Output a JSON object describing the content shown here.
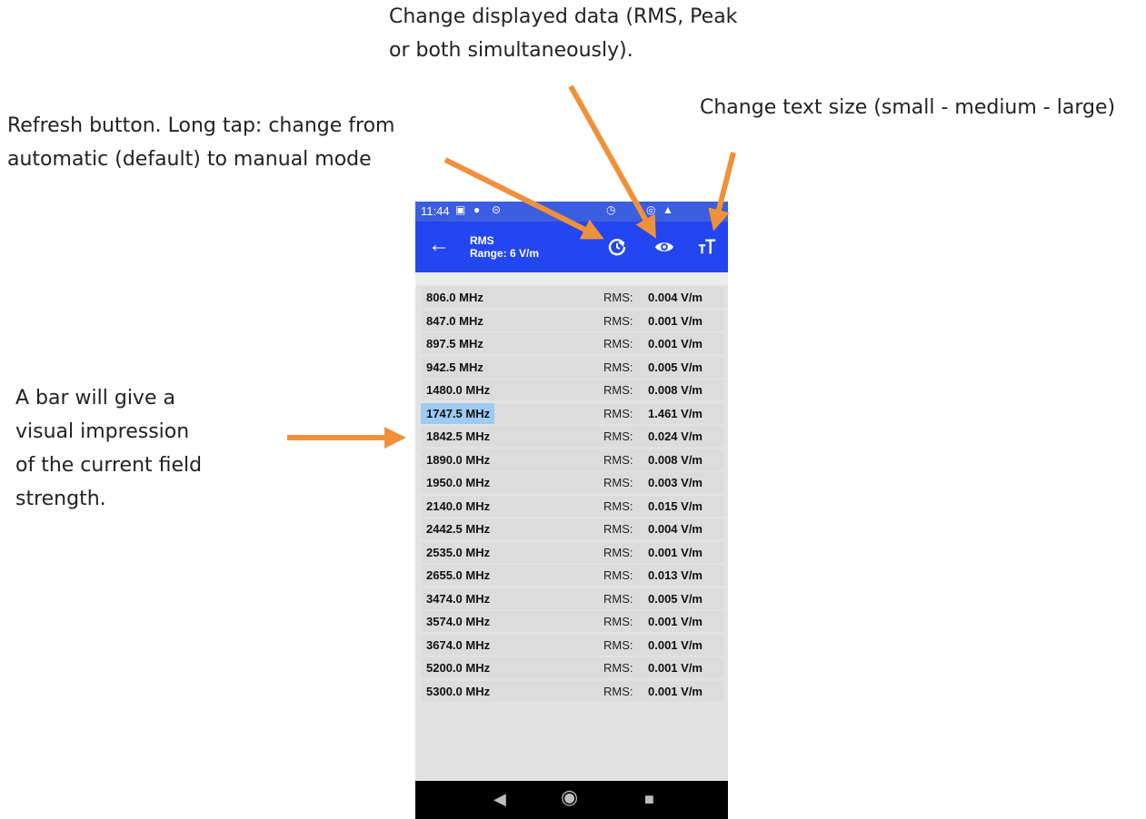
{
  "annotations": {
    "display_data": [
      "Change displayed data (RMS, Peak",
      "or both simultaneously)."
    ],
    "refresh": [
      "Refresh button. Long tap: change from",
      "automatic (default) to manual mode"
    ],
    "text_size": [
      "Change text size (small - medium - large)"
    ],
    "bar": [
      "A bar will give a",
      "visual impression",
      "of the current field",
      "strength."
    ]
  },
  "colors": {
    "arrow": "#f0913a",
    "appbar": "#2446f0",
    "bar": "#9ecbf4"
  },
  "statusbar": {
    "time": "11:44",
    "icons": [
      "calendar-icon",
      "app-icon",
      "link-icon",
      "alarm-icon",
      "hotspot-icon",
      "signal-4g-icon"
    ]
  },
  "appbar": {
    "title": "RMS",
    "subtitle": "Range: 6 V/m",
    "back_icon": "arrow-back-icon",
    "refresh_icon": "refresh-icon",
    "eye_icon": "eye-icon",
    "textsize_icon": "text-size-icon"
  },
  "list": {
    "label": "RMS:",
    "rows": [
      {
        "freq": "806.0 MHz",
        "value": "0.004 V/m",
        "bar_fraction": 0
      },
      {
        "freq": "847.0 MHz",
        "value": "0.001 V/m",
        "bar_fraction": 0
      },
      {
        "freq": "897.5 MHz",
        "value": "0.001 V/m",
        "bar_fraction": 0
      },
      {
        "freq": "942.5 MHz",
        "value": "0.005 V/m",
        "bar_fraction": 0
      },
      {
        "freq": "1480.0 MHz",
        "value": "0.008 V/m",
        "bar_fraction": 0
      },
      {
        "freq": "1747.5 MHz",
        "value": "1.461 V/m",
        "bar_fraction": 0.2435
      },
      {
        "freq": "1842.5 MHz",
        "value": "0.024 V/m",
        "bar_fraction": 0
      },
      {
        "freq": "1890.0 MHz",
        "value": "0.008 V/m",
        "bar_fraction": 0
      },
      {
        "freq": "1950.0 MHz",
        "value": "0.003 V/m",
        "bar_fraction": 0
      },
      {
        "freq": "2140.0 MHz",
        "value": "0.015 V/m",
        "bar_fraction": 0
      },
      {
        "freq": "2442.5 MHz",
        "value": "0.004 V/m",
        "bar_fraction": 0
      },
      {
        "freq": "2535.0 MHz",
        "value": "0.001 V/m",
        "bar_fraction": 0
      },
      {
        "freq": "2655.0 MHz",
        "value": "0.013 V/m",
        "bar_fraction": 0
      },
      {
        "freq": "3474.0 MHz",
        "value": "0.005 V/m",
        "bar_fraction": 0
      },
      {
        "freq": "3574.0 MHz",
        "value": "0.001 V/m",
        "bar_fraction": 0
      },
      {
        "freq": "3674.0 MHz",
        "value": "0.001 V/m",
        "bar_fraction": 0
      },
      {
        "freq": "5200.0 MHz",
        "value": "0.001 V/m",
        "bar_fraction": 0
      },
      {
        "freq": "5300.0 MHz",
        "value": "0.001 V/m",
        "bar_fraction": 0
      }
    ]
  },
  "navbar": {
    "icons": [
      "nav-back-icon",
      "nav-home-icon",
      "nav-recents-icon"
    ]
  }
}
